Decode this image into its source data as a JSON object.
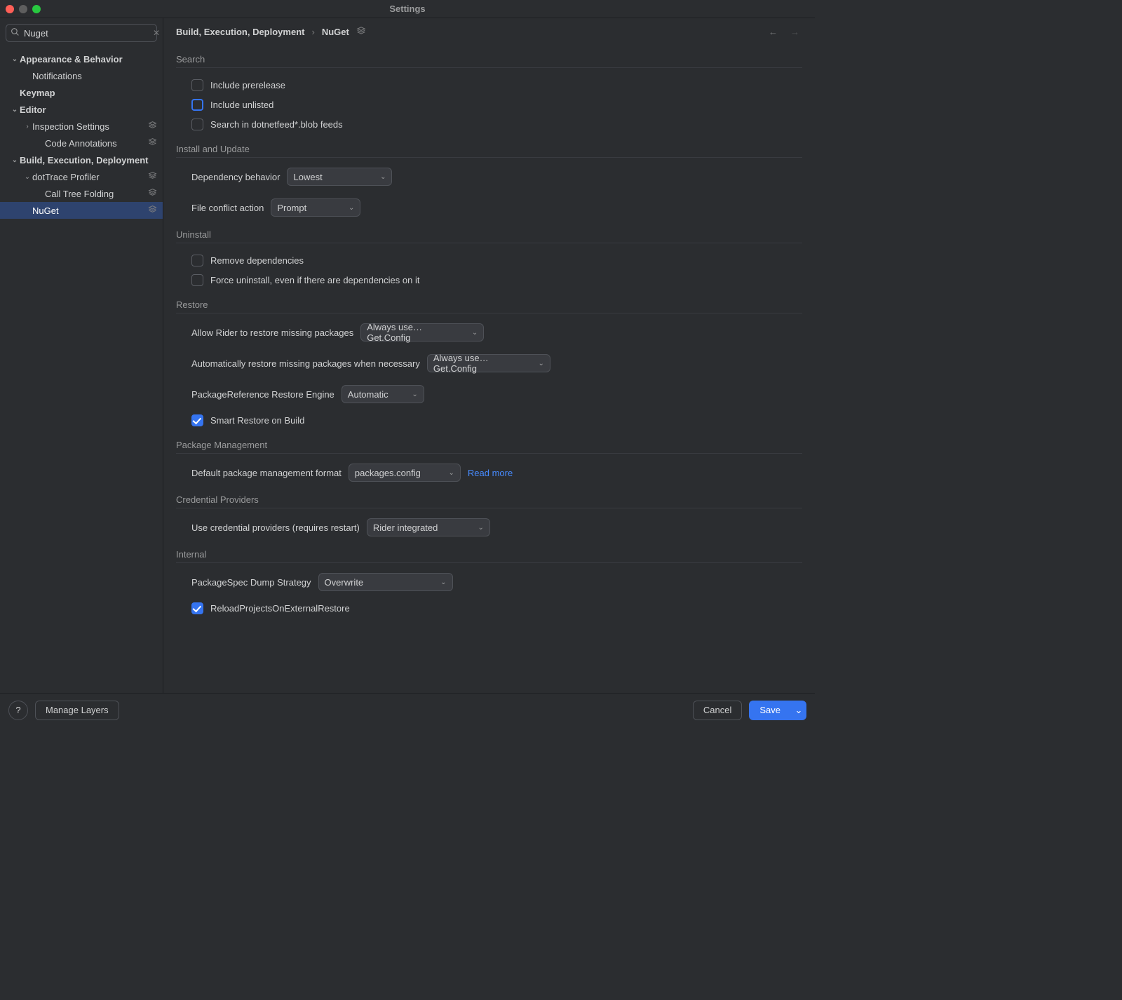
{
  "window_title": "Settings",
  "search": {
    "value": "Nuget"
  },
  "tree": [
    {
      "label": "Appearance & Behavior",
      "depth": 0,
      "bold": true,
      "chev": "down"
    },
    {
      "label": "Notifications",
      "depth": 1
    },
    {
      "label": "Keymap",
      "depth": 0,
      "bold": true
    },
    {
      "label": "Editor",
      "depth": 0,
      "bold": true,
      "chev": "down"
    },
    {
      "label": "Inspection Settings",
      "depth": 1,
      "layer": true,
      "chev": "right"
    },
    {
      "label": "Code Annotations",
      "depth": 2,
      "layer": true
    },
    {
      "label": "Build, Execution, Deployment",
      "depth": 0,
      "bold": true,
      "chev": "down"
    },
    {
      "label": "dotTrace Profiler",
      "depth": 1,
      "layer": true,
      "chev": "down"
    },
    {
      "label": "Call Tree Folding",
      "depth": 2,
      "layer": true
    },
    {
      "label": "NuGet",
      "depth": 1,
      "layer": true,
      "selected": true
    }
  ],
  "breadcrumb": [
    "Build, Execution, Deployment",
    "NuGet"
  ],
  "sections": {
    "search": {
      "heading": "Search",
      "include_prerelease": "Include prerelease",
      "include_unlisted": "Include unlisted",
      "search_dotnetfeed": "Search in dotnetfeed*.blob feeds"
    },
    "install": {
      "heading": "Install and Update",
      "dep_behavior_lbl": "Dependency behavior",
      "dep_behavior_val": "Lowest",
      "file_conflict_lbl": "File conflict action",
      "file_conflict_val": "Prompt"
    },
    "uninstall": {
      "heading": "Uninstall",
      "remove_deps": "Remove dependencies",
      "force_uninstall": "Force uninstall, even if there are dependencies on it"
    },
    "restore": {
      "heading": "Restore",
      "allow_lbl": "Allow Rider to restore missing packages",
      "allow_val": "Always use…Get.Config",
      "auto_lbl": "Automatically restore missing packages when necessary",
      "auto_val": "Always use…Get.Config",
      "engine_lbl": "PackageReference Restore Engine",
      "engine_val": "Automatic",
      "smart_restore": "Smart Restore on Build"
    },
    "pkgmgmt": {
      "heading": "Package Management",
      "fmt_lbl": "Default package management format",
      "fmt_val": "packages.config",
      "read_more": "Read more"
    },
    "cred": {
      "heading": "Credential Providers",
      "use_lbl": "Use credential providers (requires restart)",
      "use_val": "Rider integrated"
    },
    "internal": {
      "heading": "Internal",
      "dump_lbl": "PackageSpec Dump Strategy",
      "dump_val": "Overwrite",
      "reload": "ReloadProjectsOnExternalRestore"
    }
  },
  "footer": {
    "manage_layers": "Manage Layers",
    "cancel": "Cancel",
    "save": "Save"
  }
}
